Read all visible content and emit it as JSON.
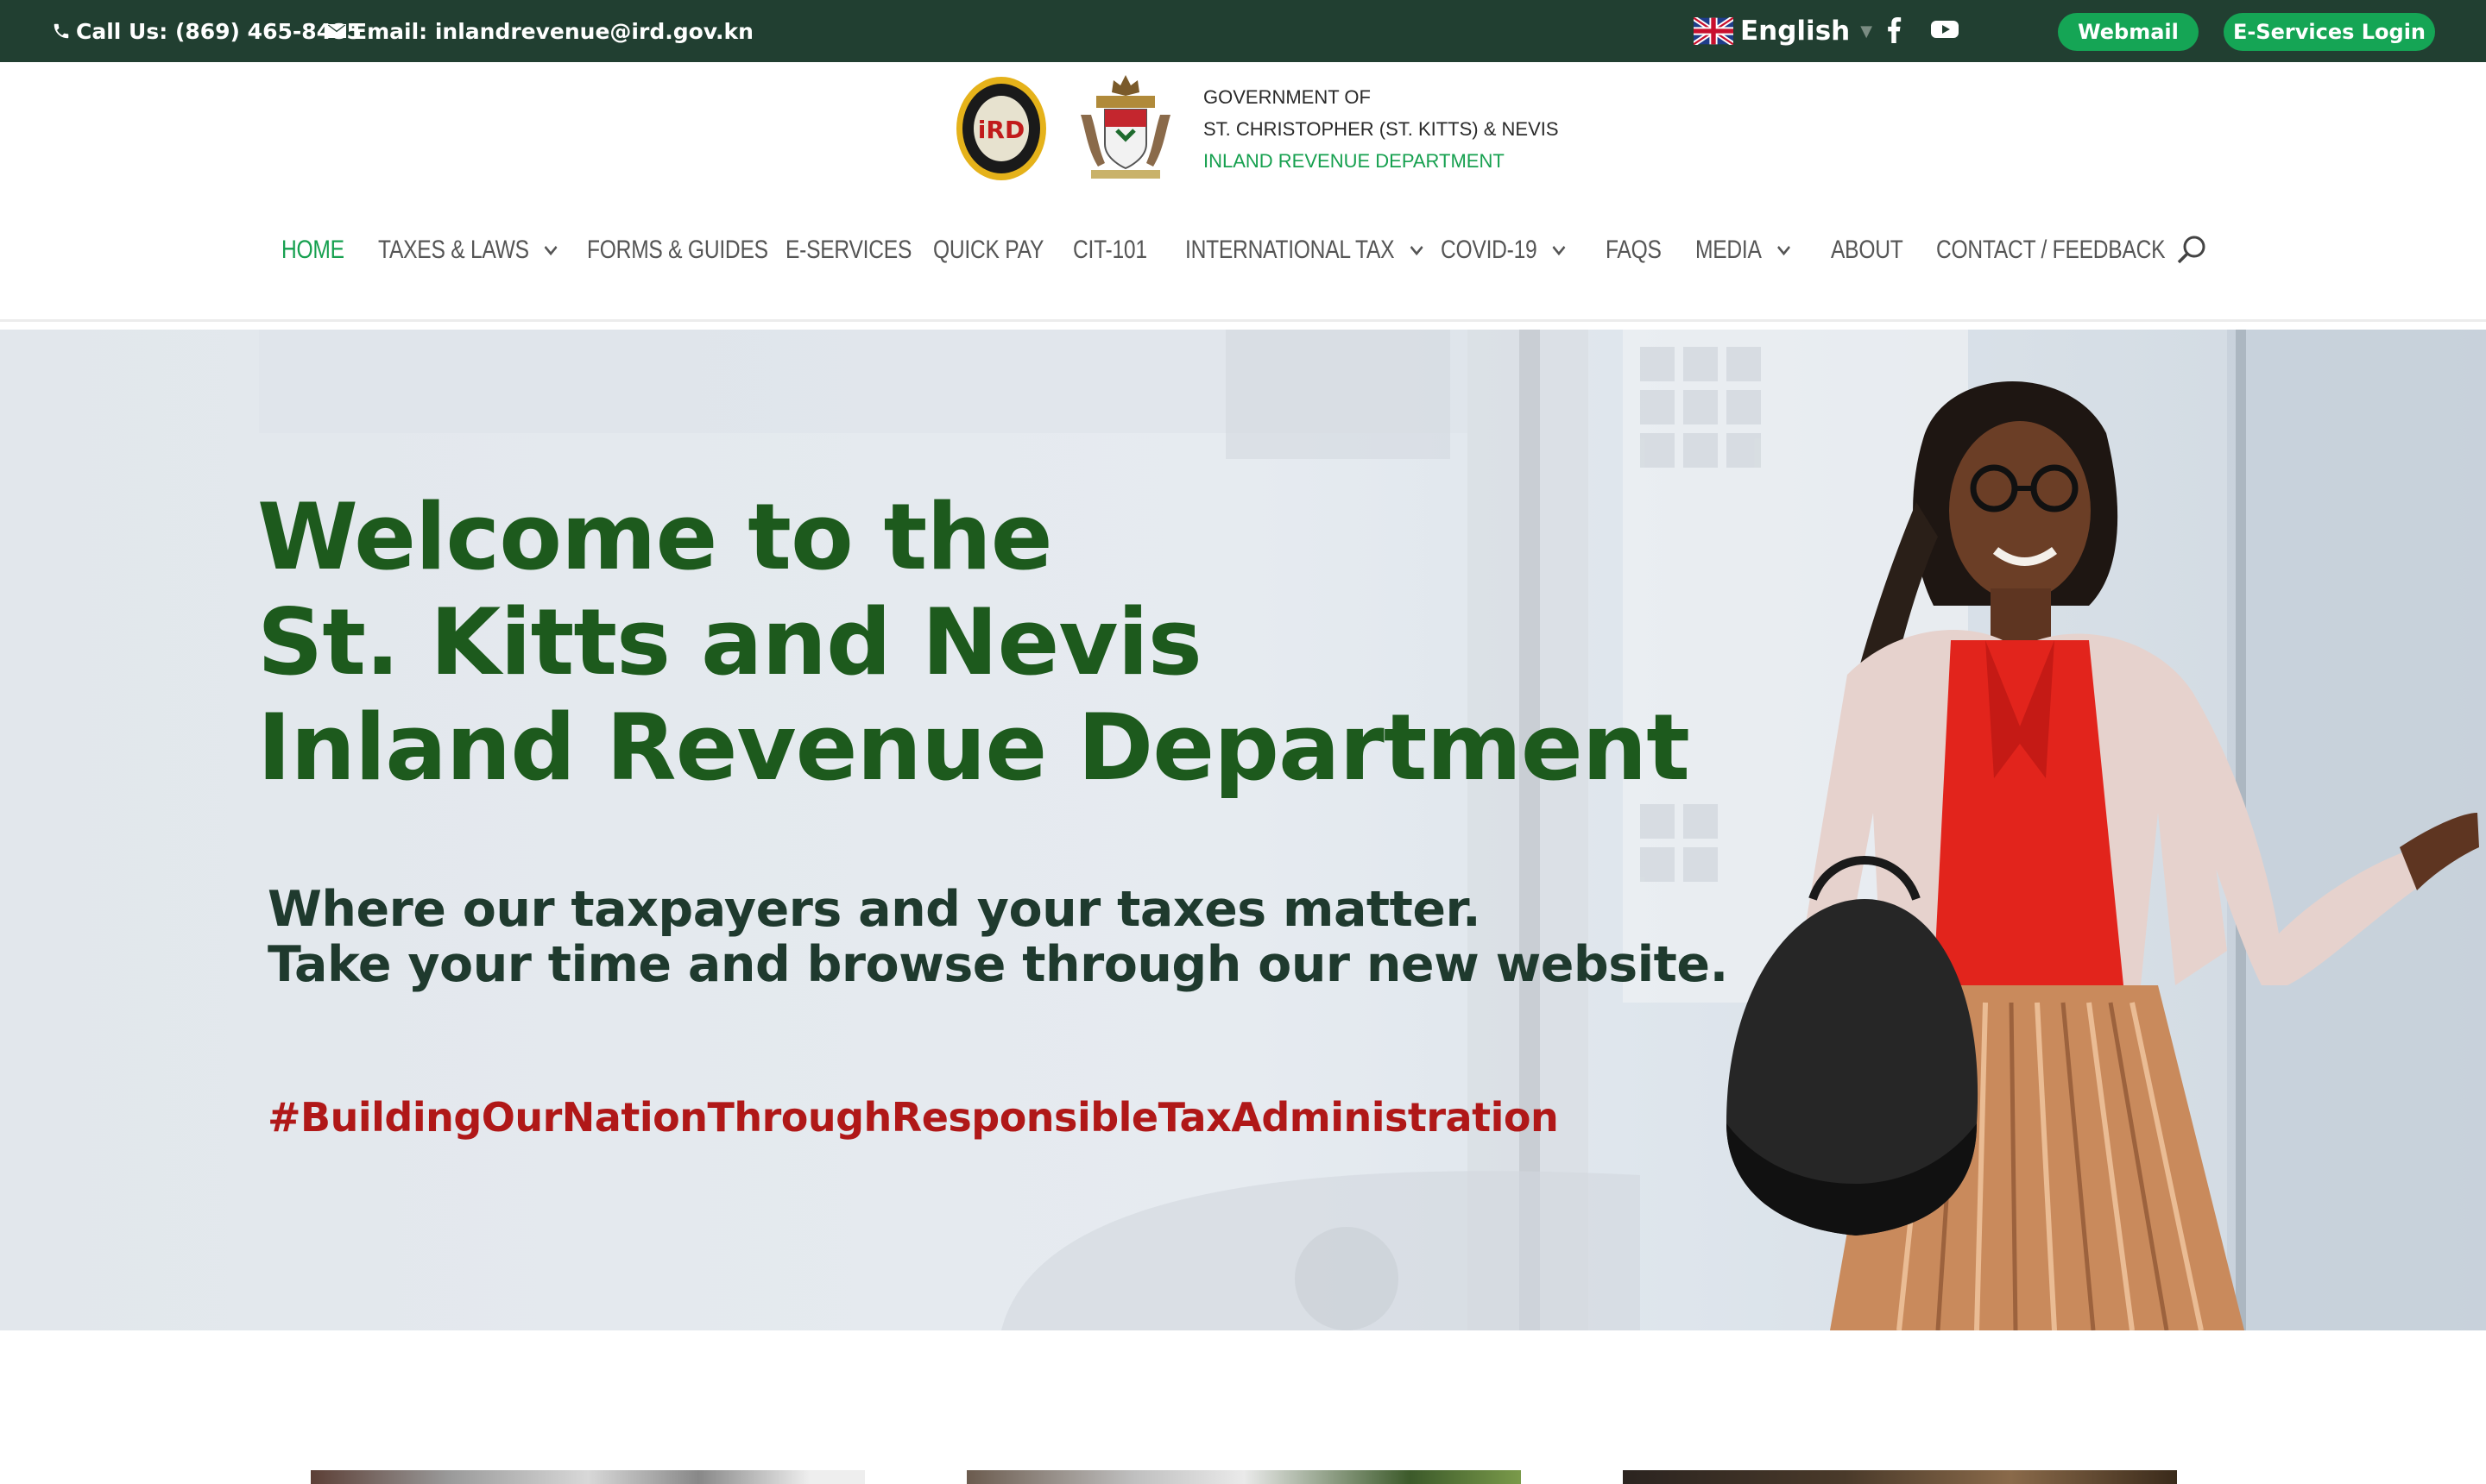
{
  "topbar": {
    "phone": "Call Us: (869) 465-8485",
    "email": "Email: inlandrevenue@ird.gov.kn",
    "language": "English",
    "social": [
      "facebook-icon",
      "youtube-icon"
    ],
    "webmail_label": "Webmail",
    "eservices_label": "E-Services Login"
  },
  "header": {
    "gov_line1": "GOVERNMENT OF",
    "gov_line2": "ST. CHRISTOPHER (ST. KITTS) & NEVIS",
    "gov_line3": "INLAND REVENUE DEPARTMENT",
    "seal_text": "iRD"
  },
  "nav": {
    "items": [
      {
        "label": "HOME"
      },
      {
        "label": "TAXES & LAWS"
      },
      {
        "label": "FORMS & GUIDES"
      },
      {
        "label": "E-SERVICES"
      },
      {
        "label": "QUICK PAY"
      },
      {
        "label": "CIT-101"
      },
      {
        "label": "INTERNATIONAL TAX"
      },
      {
        "label": "COVID-19"
      },
      {
        "label": "FAQS"
      },
      {
        "label": "MEDIA"
      },
      {
        "label": "ABOUT"
      },
      {
        "label": "CONTACT / FEEDBACK"
      }
    ],
    "active": "HOME"
  },
  "hero": {
    "title_line1": "Welcome to the",
    "title_line2": "St. Kitts and Nevis",
    "title_line3": "Inland Revenue Department",
    "sub_line1": "Where our taxpayers and your taxes matter.",
    "sub_line2": "Take your time and browse through our new website.",
    "hashtag": "#BuildingOurNationThroughResponsibleTaxAdministration"
  },
  "colors": {
    "topbar_bg": "#213f31",
    "accent_green": "#16a04f",
    "hero_title": "#1d5a1d",
    "hashtag_red": "#b01818"
  }
}
